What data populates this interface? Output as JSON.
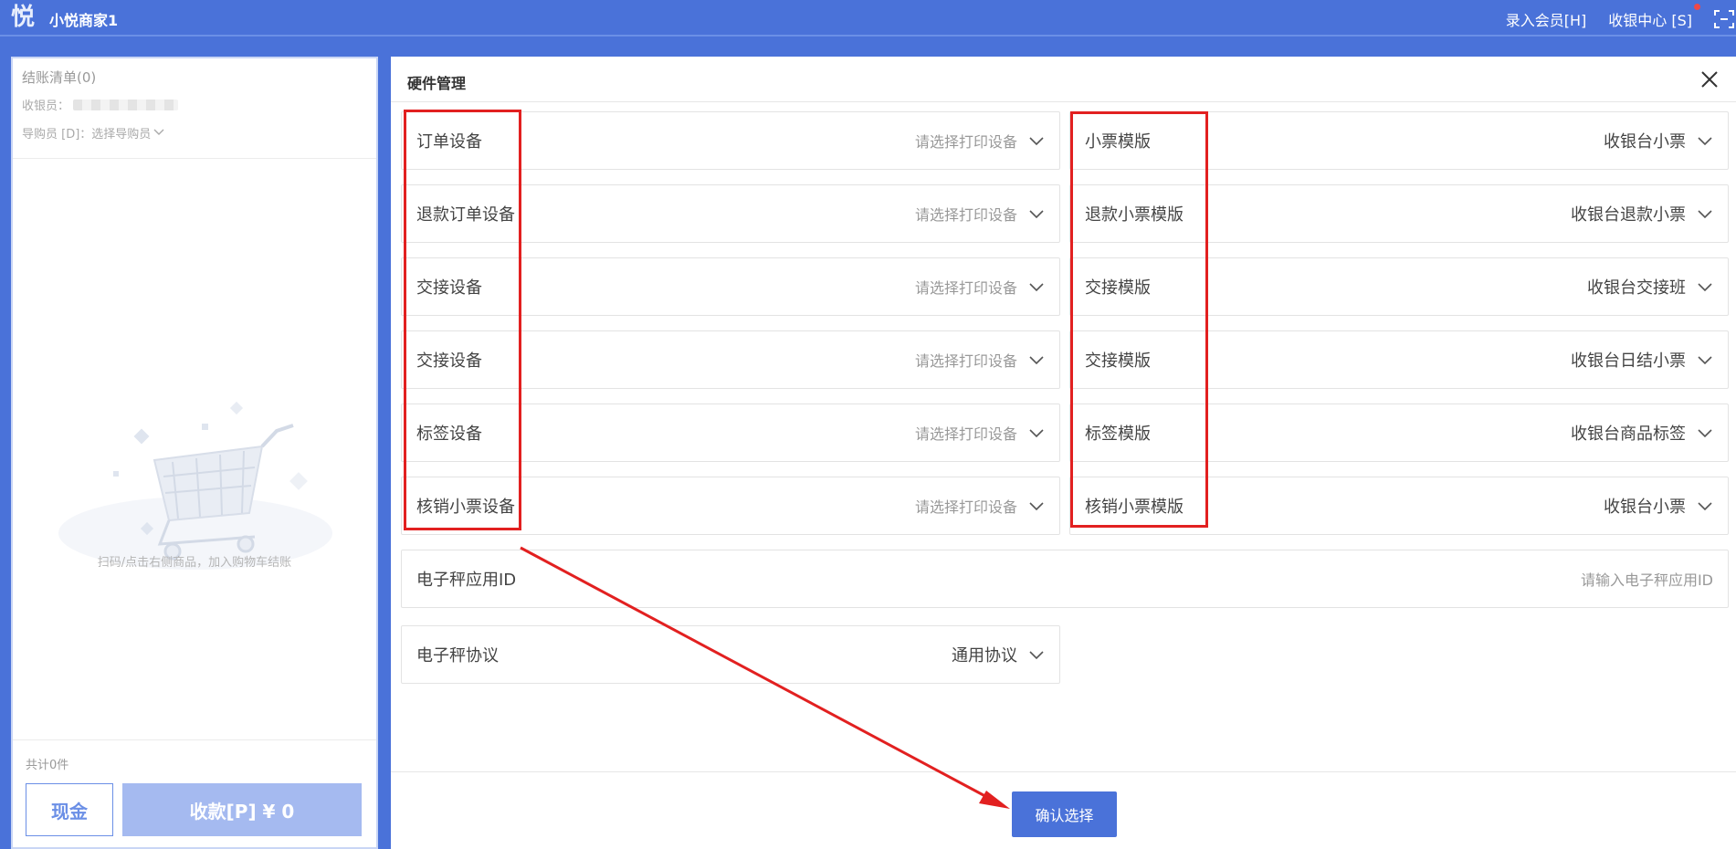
{
  "header": {
    "logo_char": "悦",
    "app_name": "小悦商家1",
    "enter_member": "录入会员[H]",
    "cashier_center": "收银中心 [S]"
  },
  "left_panel": {
    "checkout_title": "结账清单(0)",
    "cashier_label": "收银员：",
    "guide_label": "导购员 [D]：选择导购员",
    "empty_hint": "扫码/点击右侧商品，加入购物车结账",
    "count_text": "共计0件",
    "cash_button": "现金",
    "pay_button": "收款[P] ¥ 0"
  },
  "dialog": {
    "title": "硬件管理",
    "left_fields": [
      {
        "label": "订单设备",
        "value": "请选择打印设备"
      },
      {
        "label": "退款订单设备",
        "value": "请选择打印设备"
      },
      {
        "label": "交接设备",
        "value": "请选择打印设备"
      },
      {
        "label": "交接设备",
        "value": "请选择打印设备"
      },
      {
        "label": "标签设备",
        "value": "请选择打印设备"
      },
      {
        "label": "核销小票设备",
        "value": "请选择打印设备"
      }
    ],
    "right_fields": [
      {
        "label": "小票模版",
        "value": "收银台小票"
      },
      {
        "label": "退款小票模版",
        "value": "收银台退款小票"
      },
      {
        "label": "交接模版",
        "value": "收银台交接班"
      },
      {
        "label": "交接模版",
        "value": "收银台日结小票"
      },
      {
        "label": "标签模版",
        "value": "收银台商品标签"
      },
      {
        "label": "核销小票模版",
        "value": "收银台小票"
      }
    ],
    "scale_app_id": {
      "label": "电子秤应用ID",
      "placeholder": "请输入电子秤应用ID"
    },
    "scale_protocol": {
      "label": "电子秤协议",
      "value": "通用协议"
    },
    "confirm_button": "确认选择"
  },
  "colors": {
    "brand": "#4a72d9",
    "annotation": "#e22020"
  }
}
